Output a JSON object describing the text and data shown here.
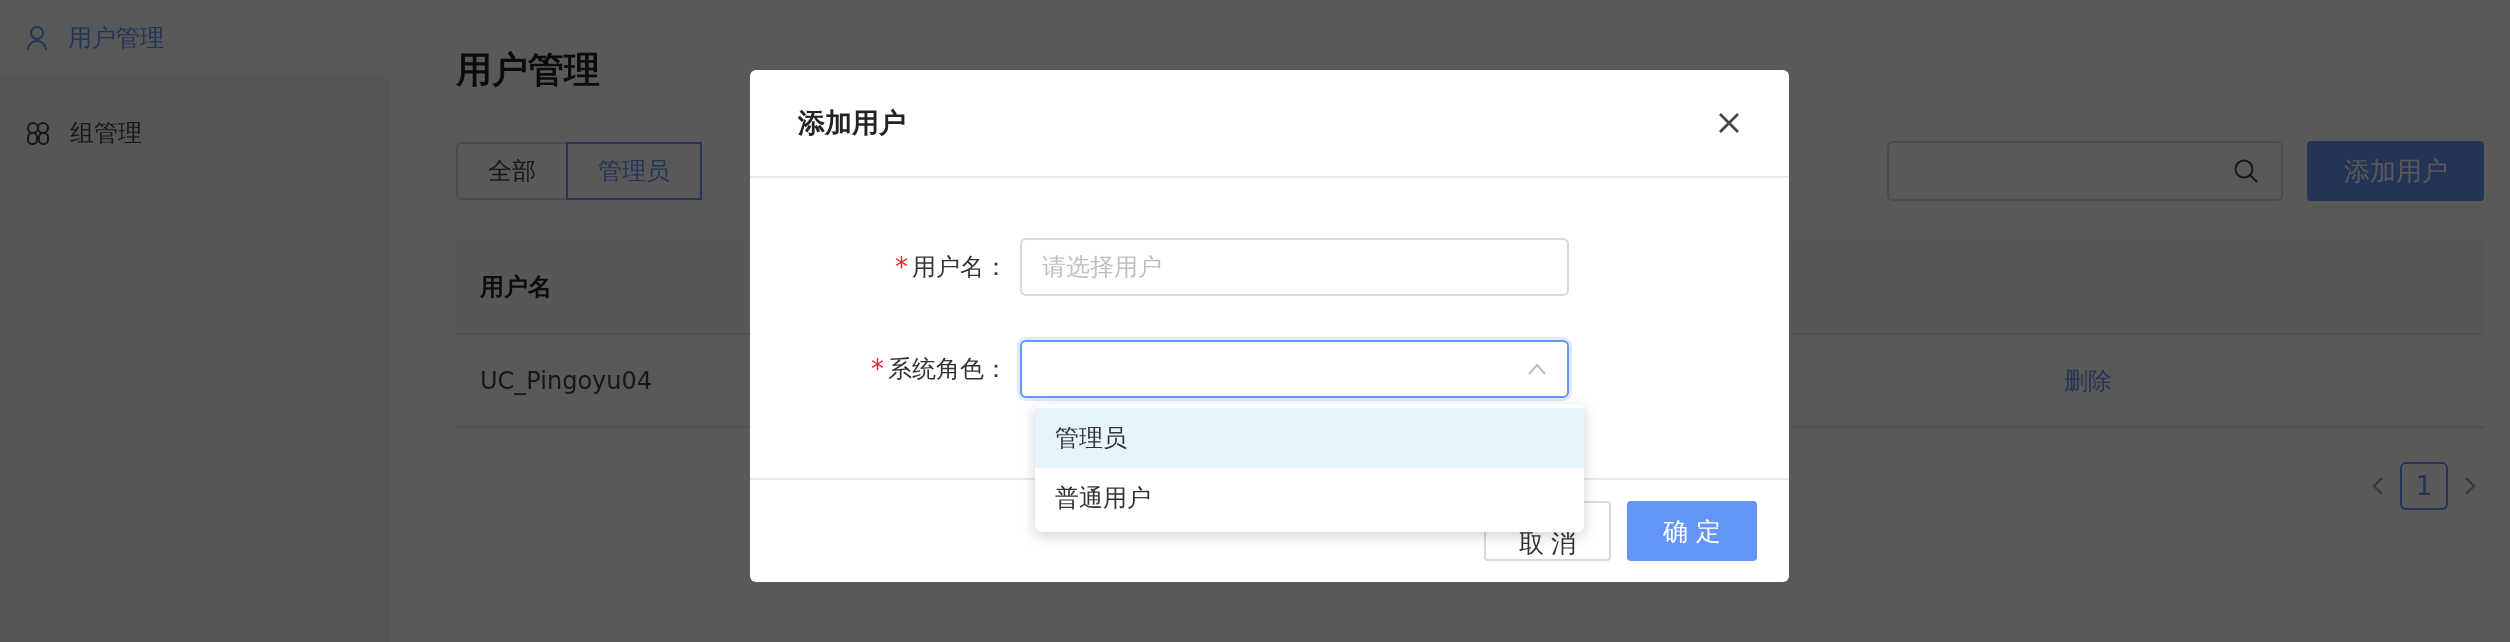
{
  "sidebar": {
    "items": [
      {
        "label": "用户管理",
        "selected": true
      },
      {
        "label": "组管理",
        "selected": false
      }
    ]
  },
  "page": {
    "title": "用户管理",
    "tabs": [
      {
        "label": "全部",
        "selected": false
      },
      {
        "label": "管理员",
        "selected": true
      }
    ],
    "add_button": "添加用户"
  },
  "table": {
    "columns": [
      "用户名"
    ],
    "rows": [
      {
        "cells": [
          "UC_Pingoyu04"
        ],
        "action": "删除"
      }
    ]
  },
  "pagination": {
    "pages": [
      {
        "label": "1",
        "selected": true
      }
    ]
  },
  "dialog": {
    "title": "添加用户",
    "fields": [
      {
        "label": "用户名：",
        "required_mark": "*",
        "kind": "input",
        "placeholder": "请选择用户",
        "focused": false
      },
      {
        "label": "系统角色：",
        "required_mark": "*",
        "kind": "select",
        "focused": true,
        "expanded": true
      }
    ],
    "options": [
      {
        "label": "管理员",
        "selected": true
      },
      {
        "label": "普通用户",
        "selected": false
      }
    ],
    "buttons": [
      {
        "label": "取 消",
        "kind": "default"
      },
      {
        "label": "确 定",
        "kind": "primary"
      }
    ]
  }
}
